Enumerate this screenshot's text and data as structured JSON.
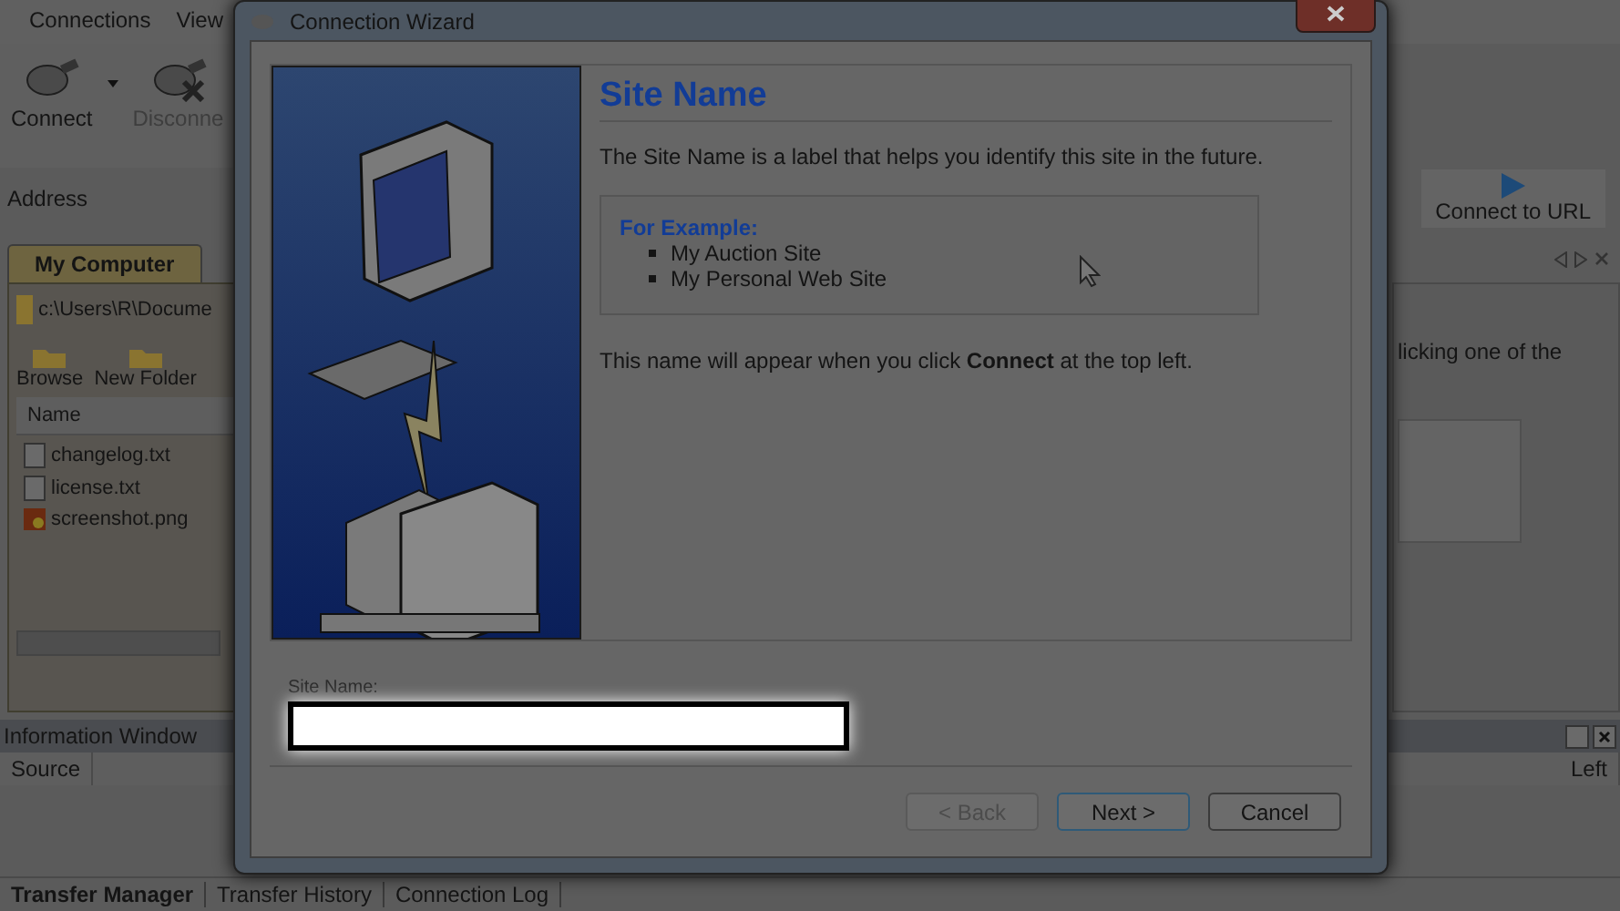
{
  "menu": [
    "Connections",
    "View"
  ],
  "toolbar": [
    {
      "label": "Connect",
      "disabled": false
    },
    {
      "label": "Disconne",
      "disabled": true
    }
  ],
  "address_label": "Address",
  "connect_url_button": "Connect to URL",
  "left_pane": {
    "tab": "My Computer",
    "path": "c:\\Users\\R\\Docume",
    "actions": [
      "Browse",
      "New Folder"
    ],
    "column": "Name",
    "files": [
      {
        "name": "changelog.txt",
        "kind": "text"
      },
      {
        "name": "license.txt",
        "kind": "text"
      },
      {
        "name": "screenshot.png",
        "kind": "image"
      }
    ]
  },
  "right_pane": {
    "text": "licking one of the"
  },
  "info_window": {
    "title": "Information Window",
    "columns": [
      "Source",
      "Left"
    ]
  },
  "bottom_tabs": [
    {
      "label": "Transfer Manager",
      "selected": true
    },
    {
      "label": "Transfer History",
      "selected": false
    },
    {
      "label": "Connection Log",
      "selected": false
    }
  ],
  "dialog": {
    "title": "Connection Wizard",
    "heading": "Site Name",
    "intro": "The Site Name is a label that helps you identify this site in the future.",
    "example": {
      "title": "For Example:",
      "items": [
        "My Auction Site",
        "My Personal Web Site"
      ]
    },
    "note": "This name will appear when you click **Connect** at the top left.",
    "field": {
      "label": "Site Name:",
      "highlighted": true
    },
    "buttons": [
      {
        "label": "< Back",
        "disabled": true,
        "default": false
      },
      {
        "label": "Next >",
        "disabled": false,
        "default": true
      },
      {
        "label": "Cancel",
        "disabled": false,
        "default": false
      }
    ]
  }
}
